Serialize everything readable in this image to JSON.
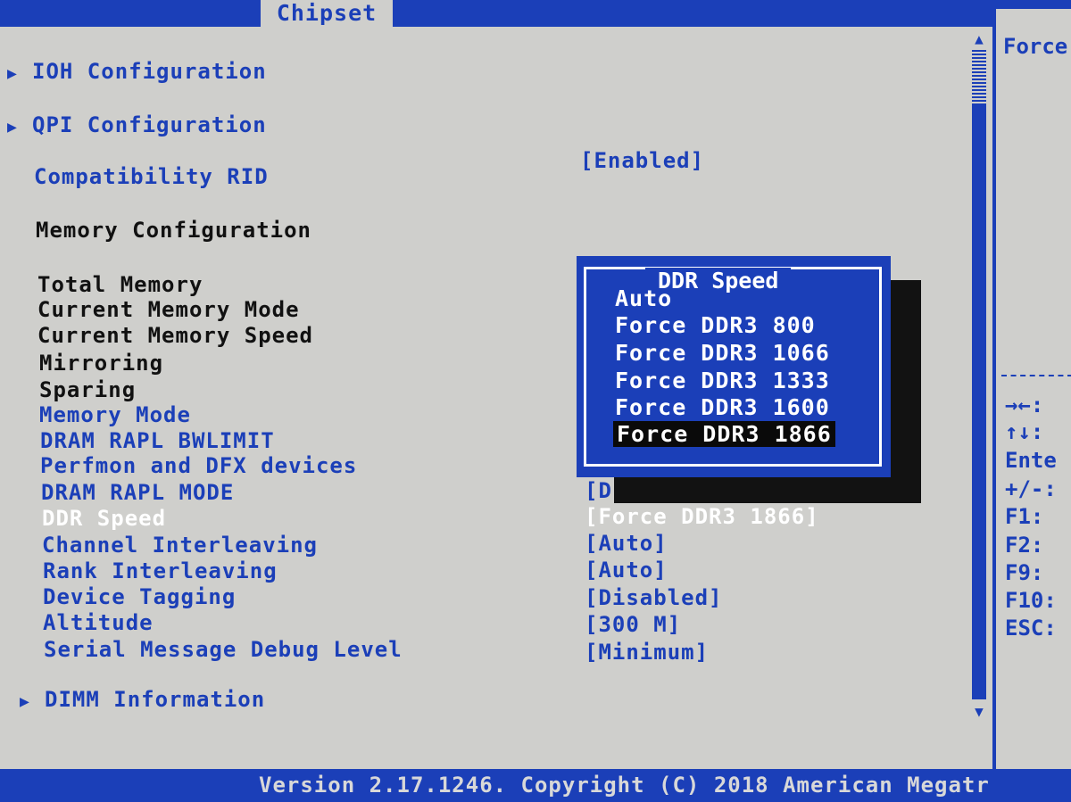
{
  "tabs": {
    "active": "Chipset"
  },
  "menu": [
    {
      "label": "IOH Configuration",
      "submenu": true
    },
    {
      "label": "QPI Configuration",
      "submenu": true
    },
    {
      "label": "Compatibility RID",
      "value": "[Enabled]"
    },
    {
      "label": "Memory Configuration"
    },
    {
      "label": "Total Memory"
    },
    {
      "label": "Current Memory Mode"
    },
    {
      "label": "Current Memory Speed"
    },
    {
      "label": "Mirroring"
    },
    {
      "label": "Sparing"
    },
    {
      "label": "Memory Mode"
    },
    {
      "label": "DRAM RAPL BWLIMIT"
    },
    {
      "label": "Perfmon and DFX devices"
    },
    {
      "label": "DRAM RAPL MODE",
      "value": "[D"
    },
    {
      "label": "DDR Speed",
      "value": "[Force DDR3 1866]"
    },
    {
      "label": "Channel Interleaving",
      "value": "[Auto]"
    },
    {
      "label": "Rank Interleaving",
      "value": "[Auto]"
    },
    {
      "label": "Device Tagging",
      "value": "[Disabled]"
    },
    {
      "label": "Altitude",
      "value": "[300 M]"
    },
    {
      "label": "Serial Message Debug Level",
      "value": "[Minimum]"
    },
    {
      "label": "DIMM Information",
      "submenu": true
    }
  ],
  "popup": {
    "title": "DDR Speed",
    "options": [
      "Auto",
      "Force DDR3 800",
      "Force DDR3 1066",
      "Force DDR3 1333",
      "Force DDR3 1600",
      "Force DDR3 1866"
    ],
    "selected": "Force DDR3 1866"
  },
  "help": {
    "title": "Force",
    "keys": [
      "→←:",
      "↑↓:",
      "Ente",
      "+/-:",
      "F1:",
      "F2:",
      "F9:",
      "F10:",
      "ESC:"
    ]
  },
  "footer": {
    "version": "Version 2.17.1246. Copyright (C) 2018 American Megatr"
  },
  "colors": {
    "bios_blue": "#1b3fb8",
    "panel_gray": "#cfcfcc",
    "highlight": "#ffffff"
  },
  "icons": {
    "submenu": "triangle-right-icon",
    "scroll_up": "triangle-up-icon",
    "scroll_down": "triangle-down-icon"
  }
}
